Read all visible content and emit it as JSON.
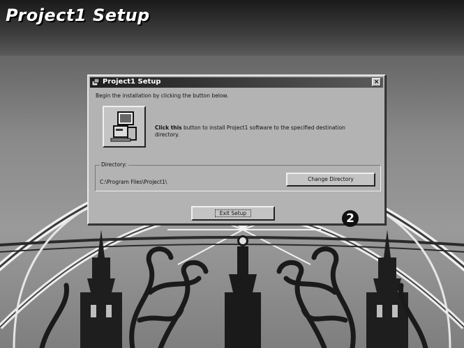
{
  "header": {
    "title": "Project1 Setup"
  },
  "dialog": {
    "title": "Project1 Setup",
    "close_label": "×",
    "intro_text": "Begin the installation by clicking the button below.",
    "instruction_bold": "Click this",
    "instruction_rest": " button to install Project1 software to the specified destination directory.",
    "directory_label": "Directory:",
    "directory_path": "C:\\Program Files\\Project1\\",
    "change_directory_label": "Change Directory",
    "exit_setup_label": "Exit Setup"
  },
  "annotation": {
    "step_number": "2"
  }
}
